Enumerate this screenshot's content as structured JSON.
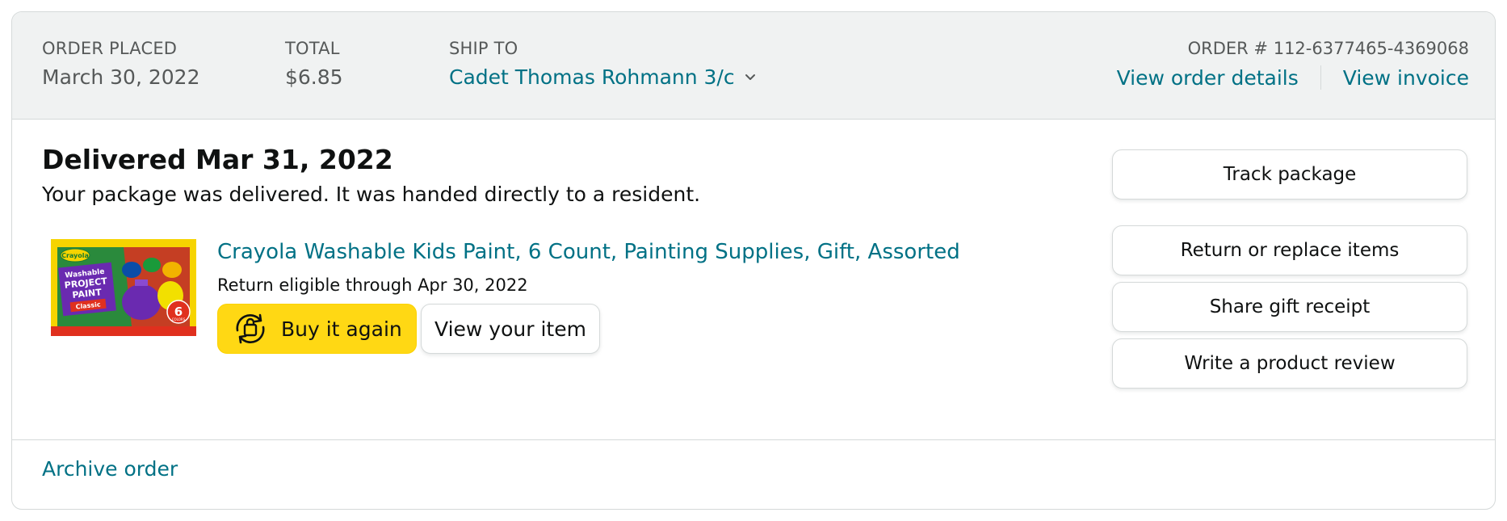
{
  "header": {
    "order_placed_label": "ORDER PLACED",
    "order_placed_value": "March 30, 2022",
    "total_label": "TOTAL",
    "total_value": "$6.85",
    "ship_to_label": "SHIP TO",
    "ship_to_value": "Cadet Thomas Rohmann 3/c",
    "ship_to_icon": "chevron-down-icon",
    "order_number": "ORDER # 112-6377465-4369068",
    "view_order_details": "View order details",
    "view_invoice": "View invoice"
  },
  "shipment": {
    "status_title": "Delivered Mar 31, 2022",
    "status_detail": "Your package was delivered. It was handed directly to a resident."
  },
  "item": {
    "title": "Crayola Washable Kids Paint, 6 Count, Painting Supplies, Gift, Assorted",
    "return_eligibility": "Return eligible through Apr 30, 2022",
    "image_text": {
      "brand": "Crayola",
      "line1": "Washable",
      "line2": "PROJECT",
      "line3": "PAINT",
      "line4": "Classic",
      "count": "6",
      "count_unit": "COLORS"
    },
    "buy_again_label": "Buy it again",
    "buy_again_icon": "reorder-icon",
    "view_item_label": "View your item"
  },
  "actions": {
    "track_package": "Track package",
    "return_replace": "Return or replace items",
    "share_gift_receipt": "Share gift receipt",
    "write_review": "Write a product review"
  },
  "footer": {
    "archive_order": "Archive order"
  },
  "colors": {
    "link": "#007185",
    "header_bg": "#f0f2f2",
    "border": "#d5d9d9",
    "buy_again_bg": "#ffd814",
    "text": "#0f1111",
    "muted_text": "#565959"
  }
}
